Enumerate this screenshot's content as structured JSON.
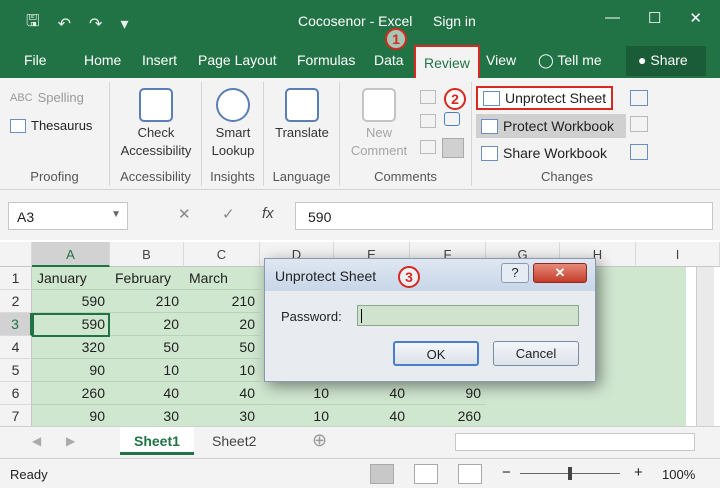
{
  "window": {
    "title": "Cocosenor - Excel",
    "sign_in": "Sign in",
    "minimize": "—",
    "restore": "☐",
    "close": "✕"
  },
  "qat": {
    "save_icon": "save-icon",
    "undo_icon": "undo-icon",
    "redo_icon": "redo-icon",
    "customize": "▾"
  },
  "menu": {
    "tabs": [
      "File",
      "Home",
      "Insert",
      "Page Layout",
      "Formulas",
      "Data",
      "Review",
      "View",
      "Tell me"
    ],
    "active": "Review",
    "share": "Share"
  },
  "ribbon": {
    "proofing": {
      "spelling": "Spelling",
      "thesaurus": "Thesaurus",
      "label": "Proofing"
    },
    "accessibility": {
      "check_line1": "Check",
      "check_line2": "Accessibility",
      "label": "Accessibility"
    },
    "insights": {
      "smart_line1": "Smart",
      "smart_line2": "Lookup",
      "label": "Insights"
    },
    "language": {
      "translate": "Translate",
      "label": "Language"
    },
    "comments": {
      "new_line1": "New",
      "new_line2": "Comment",
      "label": "Comments"
    },
    "changes": {
      "unprotect_sheet": "Unprotect Sheet",
      "protect_workbook": "Protect Workbook",
      "share_workbook": "Share Workbook",
      "label": "Changes"
    }
  },
  "annotations": {
    "step1": "1",
    "step2": "2",
    "step3": "3"
  },
  "formula_bar": {
    "name_box": "A3",
    "cancel": "✕",
    "enter": "✓",
    "fx": "fx",
    "value": "590"
  },
  "grid": {
    "columns": [
      "A",
      "B",
      "C",
      "D",
      "E",
      "F",
      "G",
      "H",
      "I"
    ],
    "rows": [
      "1",
      "2",
      "3",
      "4",
      "5",
      "6",
      "7"
    ],
    "data": [
      [
        "January",
        "February",
        "March",
        "",
        "",
        ""
      ],
      [
        "590",
        "210",
        "210",
        "",
        "",
        ""
      ],
      [
        "590",
        "20",
        "20",
        "",
        "",
        ""
      ],
      [
        "320",
        "50",
        "50",
        "",
        "",
        ""
      ],
      [
        "90",
        "10",
        "10",
        "",
        "",
        ""
      ],
      [
        "260",
        "40",
        "40",
        "10",
        "40",
        "90"
      ],
      [
        "90",
        "30",
        "30",
        "10",
        "40",
        "260"
      ]
    ],
    "active_cell": "A3"
  },
  "sheets": {
    "tabs": [
      "Sheet1",
      "Sheet2"
    ],
    "active": "Sheet1",
    "add": "⊕"
  },
  "status": {
    "text": "Ready",
    "zoom_minus": "−",
    "zoom_plus": "+",
    "zoom": "100%"
  },
  "dialog": {
    "title": "Unprotect Sheet",
    "help": "?",
    "close": "✕",
    "password_label": "Password:",
    "password_value": "",
    "ok": "OK",
    "cancel": "Cancel"
  }
}
